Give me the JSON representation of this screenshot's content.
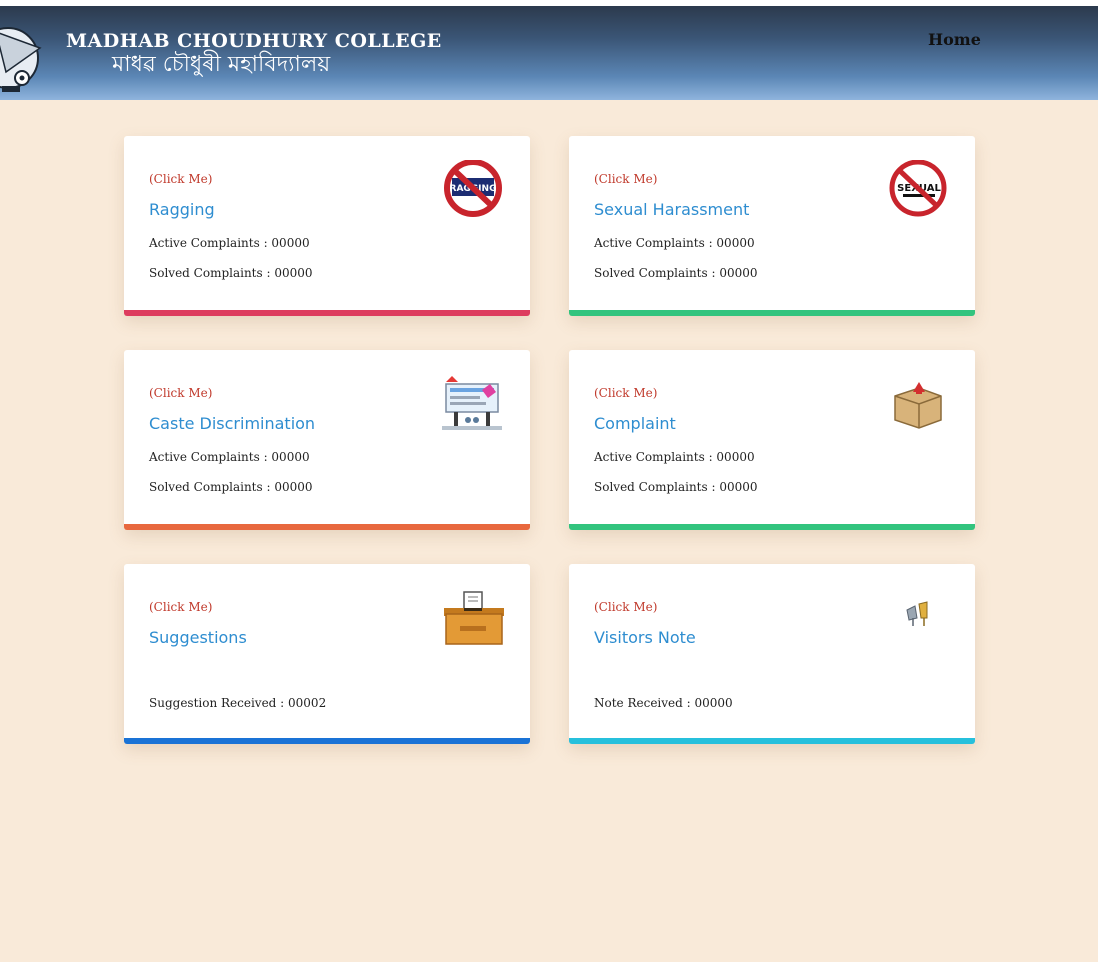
{
  "header": {
    "college_name": "MADHAB CHOUDHURY COLLEGE",
    "college_name_bn": "মাধৱ চৌধুৰী মহাবিদ্যালয়",
    "nav_home": "Home"
  },
  "cards": [
    {
      "click_label": "(Click Me)",
      "title": "Ragging",
      "icon": "no-ragging-icon",
      "icon_text": "RAGGING",
      "accent": "#dd3c5e",
      "active": "Active Complaints : 00000",
      "solved": "Solved Complaints : 00000"
    },
    {
      "click_label": "(Click Me)",
      "title": "Sexual Harassment",
      "icon": "no-sexual-harassment-icon",
      "icon_text": "SEXUAL",
      "accent": "#32c47e",
      "active": "Active Complaints : 00000",
      "solved": "Solved Complaints : 00000"
    },
    {
      "click_label": "(Click Me)",
      "title": "Caste Discrimination",
      "icon": "caste-discrimination-icon",
      "accent": "#e8683e",
      "active": "Active Complaints : 00000",
      "solved": "Solved Complaints : 00000"
    },
    {
      "click_label": "(Click Me)",
      "title": "Complaint",
      "icon": "complaint-box-icon",
      "accent": "#32c47e",
      "active": "Active Complaints : 00000",
      "solved": "Solved Complaints : 00000"
    },
    {
      "click_label": "(Click Me)",
      "title": "Suggestions",
      "icon": "suggestion-box-icon",
      "accent": "#1a73d6",
      "count": "Suggestion Received : 00002"
    },
    {
      "click_label": "(Click Me)",
      "title": "Visitors Note",
      "icon": "visitors-note-icon",
      "accent": "#26c0dc",
      "count": "Note Received : 00000"
    }
  ]
}
